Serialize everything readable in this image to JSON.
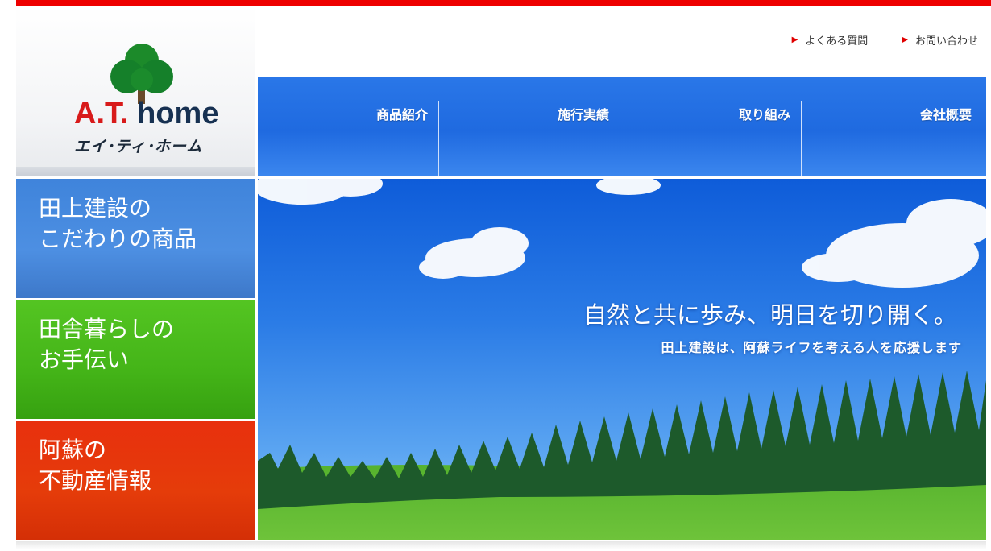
{
  "brand": {
    "name_prefix": "A.T.",
    "name_suffix": " home",
    "kana": "エイ･ティ･ホーム"
  },
  "utility": {
    "faq_label": "よくある質問",
    "contact_label": "お問い合わせ"
  },
  "nav": {
    "items": [
      {
        "label": "商品紹介"
      },
      {
        "label": "施行実績"
      },
      {
        "label": "取り組み"
      },
      {
        "label": "会社概要"
      }
    ]
  },
  "sidebar": {
    "items": [
      {
        "label": "田上建設の\nこだわりの商品",
        "color": "#3f84db"
      },
      {
        "label": "田舎暮らしの\nお手伝い",
        "color": "#4ab81c"
      },
      {
        "label": "阿蘇の\n不動産情報",
        "color": "#e5360c"
      }
    ]
  },
  "hero": {
    "headline": "自然と共に歩み、明日を切り開く。",
    "subline": "田上建設は、阿蘇ライフを考える人を応援します"
  },
  "colors": {
    "accent_red": "#ee0000",
    "nav_blue": "#2a77e8"
  }
}
